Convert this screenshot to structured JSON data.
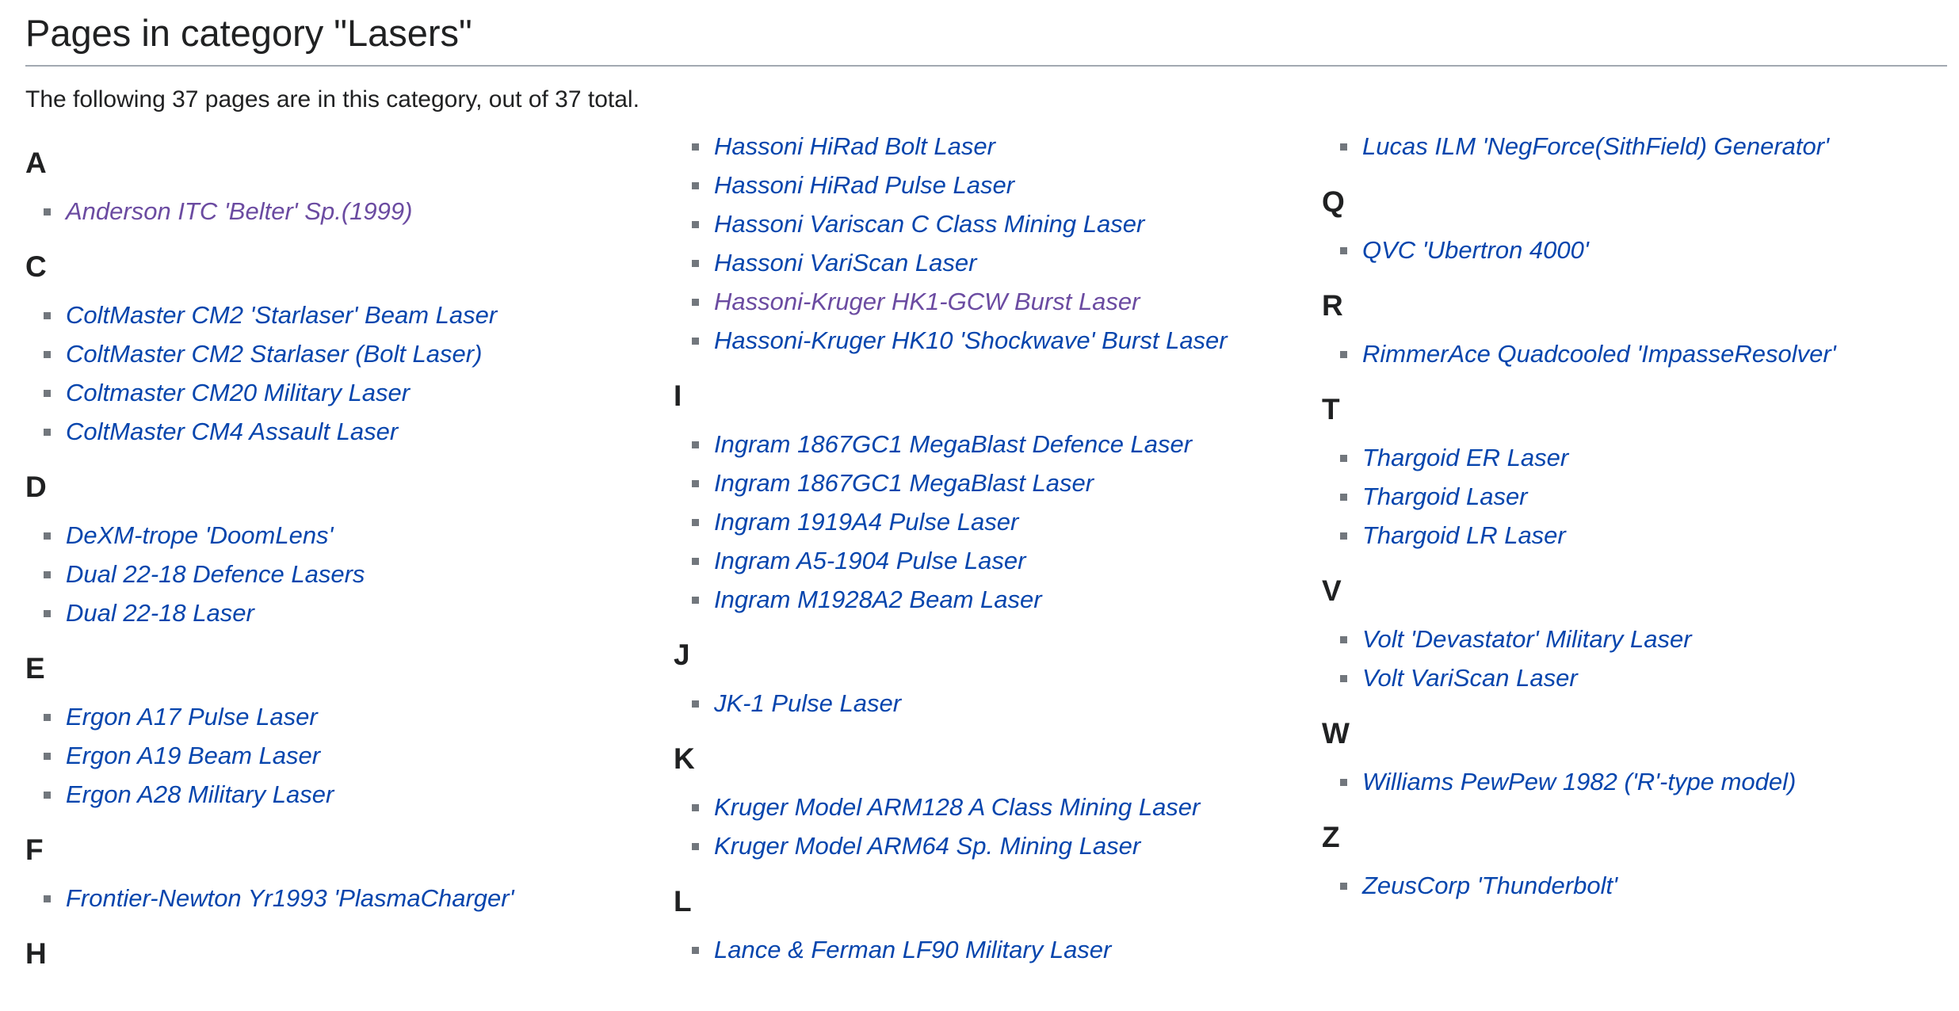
{
  "page": {
    "title": "Pages in category \"Lasers\"",
    "intro": "The following 37 pages are in this category, out of 37 total."
  },
  "colors": {
    "link": "#0645ad",
    "visited": "#6b4ba1",
    "bullet": "#72777d",
    "rule": "#a2a9b1"
  },
  "columns": [
    {
      "groups": [
        {
          "letter": "A",
          "items": [
            {
              "label": "Anderson ITC 'Belter' Sp.(1999)",
              "visited": true
            }
          ]
        },
        {
          "letter": "C",
          "items": [
            {
              "label": "ColtMaster CM2 'Starlaser' Beam Laser",
              "visited": false
            },
            {
              "label": "ColtMaster CM2 Starlaser (Bolt Laser)",
              "visited": false
            },
            {
              "label": "Coltmaster CM20 Military Laser",
              "visited": false
            },
            {
              "label": "ColtMaster CM4 Assault Laser",
              "visited": false
            }
          ]
        },
        {
          "letter": "D",
          "items": [
            {
              "label": "DeXM-trope 'DoomLens'",
              "visited": false
            },
            {
              "label": "Dual 22-18 Defence Lasers",
              "visited": false
            },
            {
              "label": "Dual 22-18 Laser",
              "visited": false
            }
          ]
        },
        {
          "letter": "E",
          "items": [
            {
              "label": "Ergon A17 Pulse Laser",
              "visited": false
            },
            {
              "label": "Ergon A19 Beam Laser",
              "visited": false
            },
            {
              "label": "Ergon A28 Military Laser",
              "visited": false
            }
          ]
        },
        {
          "letter": "F",
          "items": [
            {
              "label": "Frontier-Newton Yr1993 'PlasmaCharger'",
              "visited": false
            }
          ]
        },
        {
          "letter": "H",
          "items": []
        }
      ]
    },
    {
      "groups": [
        {
          "letter": "",
          "items": [
            {
              "label": "Hassoni HiRad Bolt Laser",
              "visited": false
            },
            {
              "label": "Hassoni HiRad Pulse Laser",
              "visited": false
            },
            {
              "label": "Hassoni Variscan C Class Mining Laser",
              "visited": false
            },
            {
              "label": "Hassoni VariScan Laser",
              "visited": false
            },
            {
              "label": "Hassoni-Kruger HK1-GCW Burst Laser",
              "visited": true
            },
            {
              "label": "Hassoni-Kruger HK10 'Shockwave' Burst Laser",
              "visited": false
            }
          ]
        },
        {
          "letter": "I",
          "items": [
            {
              "label": "Ingram 1867GC1 MegaBlast Defence Laser",
              "visited": false
            },
            {
              "label": "Ingram 1867GC1 MegaBlast Laser",
              "visited": false
            },
            {
              "label": "Ingram 1919A4 Pulse Laser",
              "visited": false
            },
            {
              "label": "Ingram A5-1904 Pulse Laser",
              "visited": false
            },
            {
              "label": "Ingram M1928A2 Beam Laser",
              "visited": false
            }
          ]
        },
        {
          "letter": "J",
          "items": [
            {
              "label": "JK-1 Pulse Laser",
              "visited": false
            }
          ]
        },
        {
          "letter": "K",
          "items": [
            {
              "label": "Kruger Model ARM128 A Class Mining Laser",
              "visited": false
            },
            {
              "label": "Kruger Model ARM64 Sp. Mining Laser",
              "visited": false
            }
          ]
        },
        {
          "letter": "L",
          "items": [
            {
              "label": "Lance & Ferman LF90 Military Laser",
              "visited": false
            }
          ]
        }
      ]
    },
    {
      "groups": [
        {
          "letter": "",
          "items": [
            {
              "label": "Lucas ILM 'NegForce(SithField) Generator'",
              "visited": false
            }
          ]
        },
        {
          "letter": "Q",
          "items": [
            {
              "label": "QVC 'Ubertron 4000'",
              "visited": false
            }
          ]
        },
        {
          "letter": "R",
          "items": [
            {
              "label": "RimmerAce Quadcooled 'ImpasseResolver'",
              "visited": false
            }
          ]
        },
        {
          "letter": "T",
          "items": [
            {
              "label": "Thargoid ER Laser",
              "visited": false
            },
            {
              "label": "Thargoid Laser",
              "visited": false
            },
            {
              "label": "Thargoid LR Laser",
              "visited": false
            }
          ]
        },
        {
          "letter": "V",
          "items": [
            {
              "label": "Volt 'Devastator' Military Laser",
              "visited": false
            },
            {
              "label": "Volt VariScan Laser",
              "visited": false
            }
          ]
        },
        {
          "letter": "W",
          "items": [
            {
              "label": "Williams PewPew 1982 ('R'-type model)",
              "visited": false
            }
          ]
        },
        {
          "letter": "Z",
          "items": [
            {
              "label": "ZeusCorp 'Thunderbolt'",
              "visited": false
            }
          ]
        }
      ]
    }
  ]
}
